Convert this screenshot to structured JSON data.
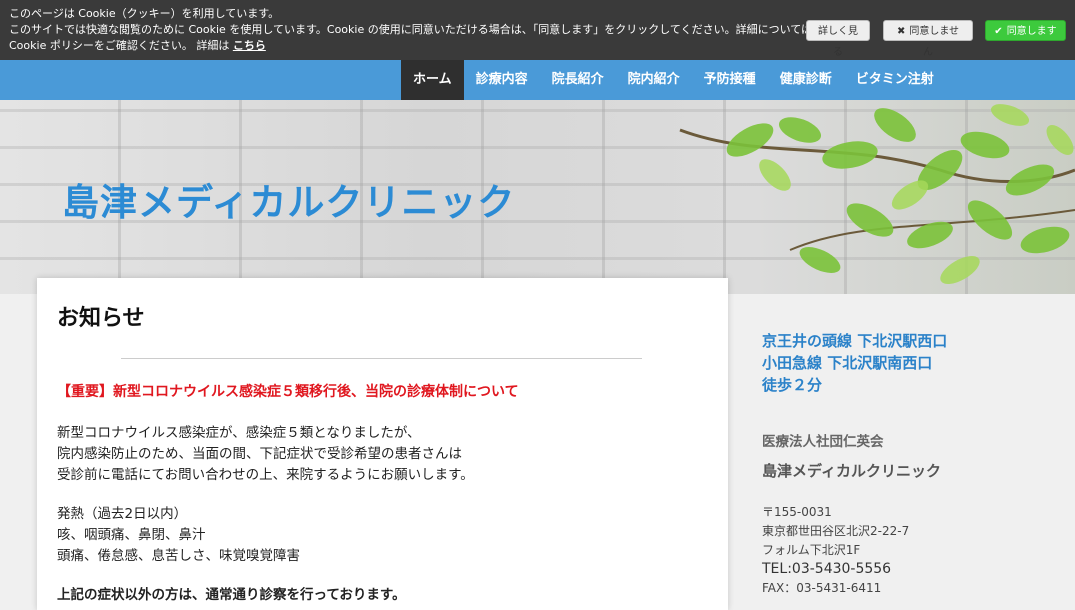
{
  "cookie": {
    "line1": "このページは Cookie（クッキー）を利用しています。",
    "line2": "このサイトでは快適な閲覧のために Cookie を使用しています。Cookie の使用に同意いただける場合は、「同意します」をクリックしてください。詳細については",
    "line3": "Cookie ポリシーをご確認ください。 詳細は ",
    "link": "こちら",
    "more_label": "詳しく見る",
    "deny_label": "同意しません",
    "accept_label": "同意します"
  },
  "nav": {
    "items": [
      {
        "label": "ホーム"
      },
      {
        "label": "診療内容"
      },
      {
        "label": "院長紹介"
      },
      {
        "label": "院内紹介"
      },
      {
        "label": "予防接種"
      },
      {
        "label": "健康診断"
      },
      {
        "label": "ビタミン注射"
      }
    ]
  },
  "hero": {
    "title": "島津メディカルクリニック"
  },
  "main": {
    "heading": "お知らせ",
    "alert": "【重要】新型コロナウイルス感染症５類移行後、当院の診療体制について",
    "para1": [
      "新型コロナウイルス感染症が、感染症５類となりましたが、",
      "院内感染防止のため、当面の間、下記症状で受診希望の患者さんは",
      "受診前に電話にてお問い合わせの上、来院するようにお願いします。"
    ],
    "para2": [
      "発熱（過去2日以内）",
      "咳、咽頭痛、鼻閉、鼻汁",
      "頭痛、倦怠感、息苦しさ、味覚嗅覚障害"
    ],
    "para3": "上記の症状以外の方は、通常通り診察を行っております。"
  },
  "sidebar": {
    "access": [
      "京王井の頭線 下北沢駅西口",
      "小田急線 下北沢駅南西口",
      "徒歩２分"
    ],
    "org": "医療法人社団仁英会",
    "clinic": "島津メディカルクリニック",
    "postal": "〒155-0031",
    "address1": "東京都世田谷区北沢2-22-7",
    "address2": "フォルム下北沢1F",
    "tel": "TEL:03-5430-5556",
    "fax": "FAX：03-5431-6411"
  },
  "colors": {
    "nav_bg": "#4a9ad8",
    "accent_blue": "#2c8bd4",
    "alert_red": "#e0171f",
    "accept_green": "#3dca3d"
  }
}
